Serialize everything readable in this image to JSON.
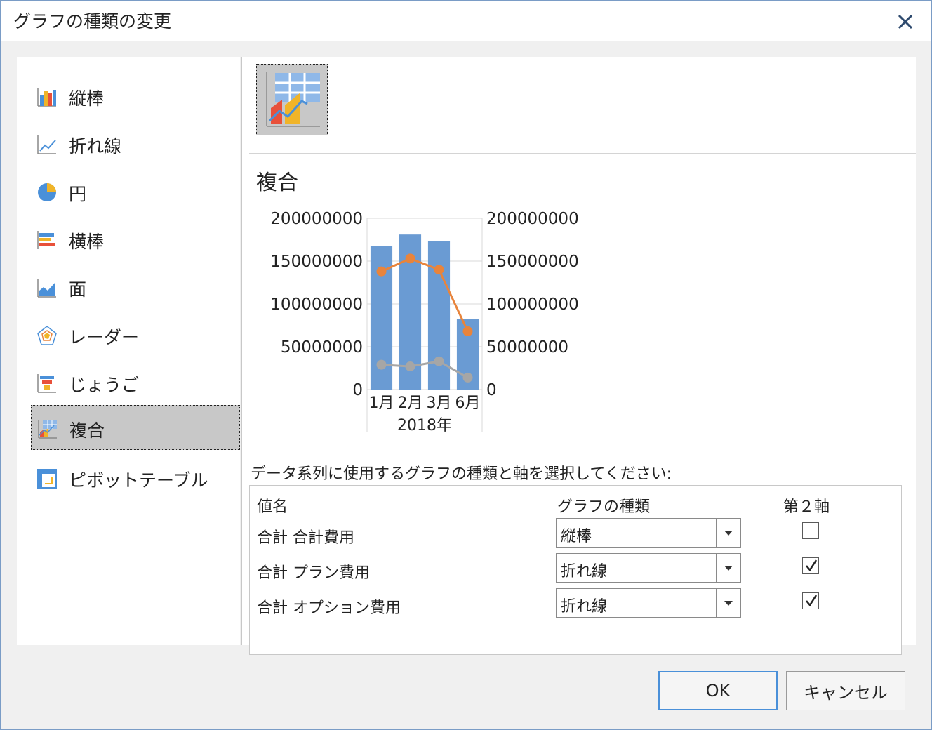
{
  "dialog": {
    "title": "グラフの種類の変更"
  },
  "chart_types": [
    {
      "label": "縦棒",
      "icon": "column-chart-icon"
    },
    {
      "label": "折れ線",
      "icon": "line-chart-icon"
    },
    {
      "label": "円",
      "icon": "pie-chart-icon"
    },
    {
      "label": "横棒",
      "icon": "bar-chart-icon"
    },
    {
      "label": "面",
      "icon": "area-chart-icon"
    },
    {
      "label": "レーダー",
      "icon": "radar-chart-icon"
    },
    {
      "label": "じょうご",
      "icon": "funnel-chart-icon"
    },
    {
      "label": "複合",
      "icon": "combo-chart-icon",
      "selected": true
    },
    {
      "label": "ピボットテーブル",
      "icon": "pivot-table-icon"
    }
  ],
  "preview": {
    "subtype_title": "複合"
  },
  "chart_data": {
    "type": "bar",
    "categories": [
      "1月",
      "2月",
      "3月",
      "6月"
    ],
    "group_label": "2018年",
    "ylim": [
      0,
      200000000
    ],
    "y_ticks": [
      "0",
      "50000000",
      "100000000",
      "150000000",
      "200000000"
    ],
    "y2lim": [
      0,
      200000000
    ],
    "y2_ticks": [
      "0",
      "50000000",
      "100000000",
      "150000000",
      "200000000"
    ],
    "series": [
      {
        "values": [
          168000000,
          181000000,
          173000000,
          82000000
        ],
        "kind": "bar",
        "axis": "primary",
        "color": "#6a9bd3"
      },
      {
        "values": [
          138000000,
          153000000,
          140000000,
          68000000
        ],
        "kind": "line",
        "axis": "secondary",
        "color": "#e8843c"
      },
      {
        "values": [
          29000000,
          27000000,
          33000000,
          14000000
        ],
        "kind": "line",
        "axis": "secondary",
        "color": "#a6a6a6"
      }
    ],
    "grid": true
  },
  "series_panel": {
    "instruction": "データ系列に使用するグラフの種類と軸を選択してください:",
    "headers": {
      "name": "値名",
      "type": "グラフの種類",
      "secondary": "第２軸"
    },
    "rows": [
      {
        "name": "合計 合計費用",
        "type": "縦棒",
        "secondary": false
      },
      {
        "name": "合計 プラン費用",
        "type": "折れ線",
        "secondary": true
      },
      {
        "name": "合計 オプション費用",
        "type": "折れ線",
        "secondary": true
      }
    ]
  },
  "buttons": {
    "ok": "OK",
    "cancel": "キャンセル"
  }
}
